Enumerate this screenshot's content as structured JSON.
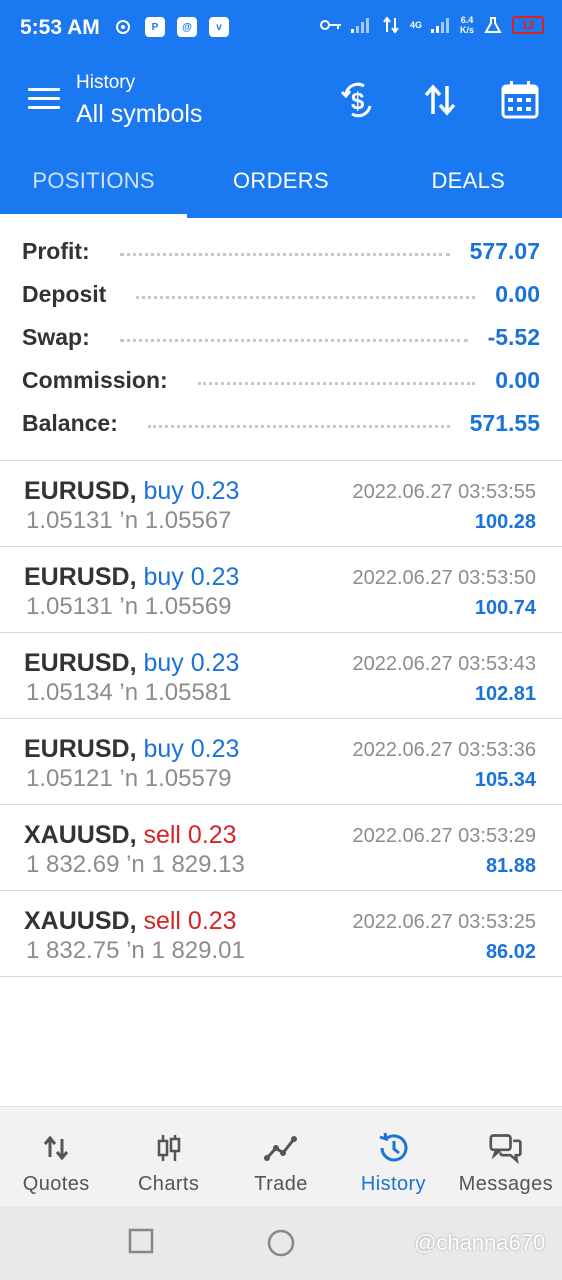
{
  "status_bar": {
    "time": "5:53 AM",
    "net_speed_top": "6.4",
    "net_speed_bottom": "K/s",
    "network_type": "4G",
    "battery": "12"
  },
  "app_bar": {
    "subtitle": "History",
    "title": "All symbols",
    "icons": [
      "menu-icon",
      "currency-exchange-icon",
      "sort-icon",
      "calendar-icon"
    ]
  },
  "tabs": [
    {
      "label": "POSITIONS",
      "active": true
    },
    {
      "label": "ORDERS",
      "active": false
    },
    {
      "label": "DEALS",
      "active": false
    }
  ],
  "summary": [
    {
      "label": "Profit:",
      "value": "577.07"
    },
    {
      "label": "Deposit",
      "value": "0.00"
    },
    {
      "label": "Swap:",
      "value": "-5.52"
    },
    {
      "label": "Commission:",
      "value": "0.00"
    },
    {
      "label": "Balance:",
      "value": "571.55"
    }
  ],
  "positions": [
    {
      "symbol": "EURUSD,",
      "side": "buy 0.23",
      "side_type": "buy",
      "prices": "1.05131 ’n  1.05567",
      "time": "2022.06.27 03:53:55",
      "profit": "100.28"
    },
    {
      "symbol": "EURUSD,",
      "side": "buy 0.23",
      "side_type": "buy",
      "prices": "1.05131 ’n  1.05569",
      "time": "2022.06.27 03:53:50",
      "profit": "100.74"
    },
    {
      "symbol": "EURUSD,",
      "side": "buy 0.23",
      "side_type": "buy",
      "prices": "1.05134 ’n  1.05581",
      "time": "2022.06.27 03:53:43",
      "profit": "102.81"
    },
    {
      "symbol": "EURUSD,",
      "side": "buy 0.23",
      "side_type": "buy",
      "prices": "1.05121 ’n  1.05579",
      "time": "2022.06.27 03:53:36",
      "profit": "105.34"
    },
    {
      "symbol": "XAUUSD,",
      "side": "sell 0.23",
      "side_type": "sell",
      "prices": "1 832.69 ’n  1 829.13",
      "time": "2022.06.27 03:53:29",
      "profit": "81.88"
    },
    {
      "symbol": "XAUUSD,",
      "side": "sell 0.23",
      "side_type": "sell",
      "prices": "1 832.75 ’n  1 829.01",
      "time": "2022.06.27 03:53:25",
      "profit": "86.02"
    }
  ],
  "bottom_nav": [
    {
      "label": "Quotes",
      "icon": "quotes-icon",
      "active": false
    },
    {
      "label": "Charts",
      "icon": "candlestick-icon",
      "active": false
    },
    {
      "label": "Trade",
      "icon": "trend-icon",
      "active": false
    },
    {
      "label": "History",
      "icon": "history-icon",
      "active": true
    },
    {
      "label": "Messages",
      "icon": "messages-icon",
      "active": false
    }
  ],
  "watermark": "@channa670",
  "colors": {
    "primary": "#1a78f0",
    "buy": "#1a73d9",
    "sell": "#d42525",
    "muted": "#8c8c8c"
  }
}
